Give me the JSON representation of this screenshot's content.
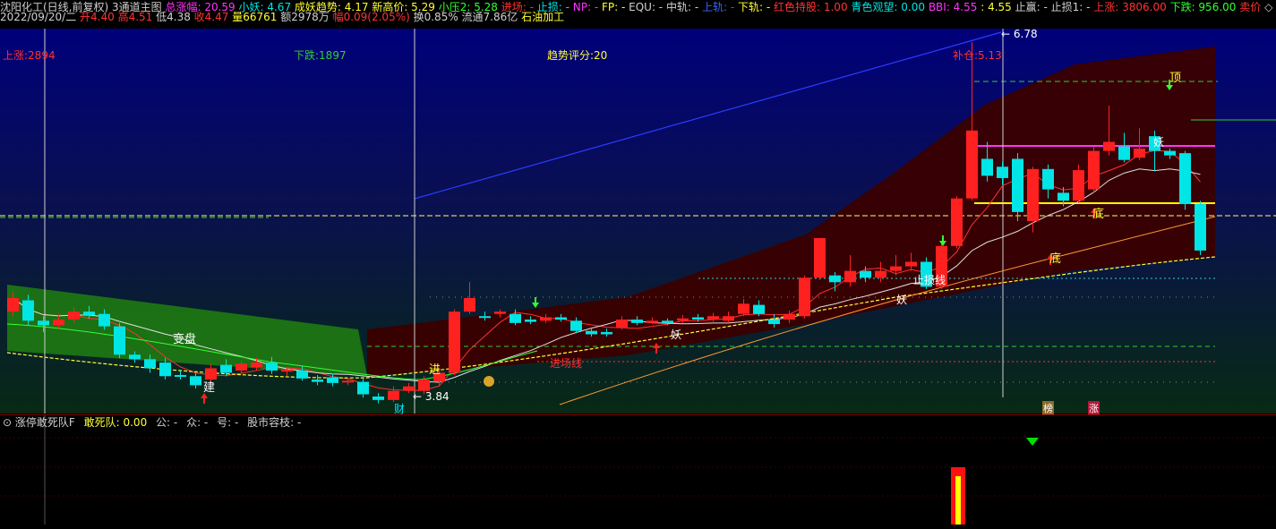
{
  "header_row1": [
    {
      "text": "沈阳化工(日线,前复权)",
      "color": "#d0d0d0"
    },
    {
      "text": " ",
      "color": "#d0d0d0"
    },
    {
      "text": "3通道主图",
      "color": "#d0d0d0"
    },
    {
      "text": " 总涨幅: 20.59",
      "color": "#ff33ff"
    },
    {
      "text": " 小妖: 4.67",
      "color": "#00e5e5"
    },
    {
      "text": " 成妖趋势: 4.17",
      "color": "#ffff33"
    },
    {
      "text": " 新高价: 5.29",
      "color": "#ffff33"
    },
    {
      "text": " 小压2: 5.28",
      "color": "#33ff33"
    },
    {
      "text": " 进场: -",
      "color": "#ff3333"
    },
    {
      "text": " 止损: -",
      "color": "#00e5e5"
    },
    {
      "text": " NP: -",
      "color": "#ff33ff"
    },
    {
      "text": " FP: -",
      "color": "#ffff33"
    },
    {
      "text": " EQU: -",
      "color": "#d0d0d0"
    },
    {
      "text": " 中轨: -",
      "color": "#d0d0d0"
    },
    {
      "text": " 上轨: -",
      "color": "#3366ff"
    },
    {
      "text": " 下轨: -",
      "color": "#ffff33"
    },
    {
      "text": " 红色持股: 1.00",
      "color": "#ff3333"
    },
    {
      "text": " 青色观望: 0.00",
      "color": "#00e5e5"
    },
    {
      "text": " BBI: 4.55",
      "color": "#ff33ff"
    },
    {
      "text": " : 4.55",
      "color": "#ffff33"
    },
    {
      "text": " 止赢: -",
      "color": "#d0d0d0"
    },
    {
      "text": " 止损1: -",
      "color": "#d0d0d0"
    },
    {
      "text": " 上涨: 3806.00",
      "color": "#ff3333"
    },
    {
      "text": " 下跌: 956.00",
      "color": "#33ff33"
    },
    {
      "text": " 卖价",
      "color": "#ff3333"
    },
    {
      "text": " ◇",
      "color": "#d0d0d0"
    }
  ],
  "header_row2": [
    {
      "text": "2022/09/20/二",
      "color": "#d0d0d0"
    },
    {
      "text": " 开4.40",
      "color": "#ff3333"
    },
    {
      "text": " 高4.51",
      "color": "#ff3333"
    },
    {
      "text": " 低4.38",
      "color": "#d0d0d0"
    },
    {
      "text": " 收4.47",
      "color": "#ff3333"
    },
    {
      "text": " 量66761",
      "color": "#ffff33"
    },
    {
      "text": " 额2978万",
      "color": "#d0d0d0"
    },
    {
      "text": " 幅0.09(2.05%)",
      "color": "#ff3333"
    },
    {
      "text": " 换0.85%",
      "color": "#d0d0d0"
    },
    {
      "text": " 流通7.86亿",
      "color": "#d0d0d0"
    },
    {
      "text": " 石油加工",
      "color": "#ffff33"
    }
  ],
  "chart_labels": {
    "up_count": "上涨:2894",
    "down_count": "下跌:1897",
    "trend_score": "趋势评分:20",
    "add_position": "补仓:5.13",
    "high_marker": "6.78",
    "low_marker": "3.84",
    "enter_line": "进场线",
    "stop_line": "止损线",
    "variable": "变盘",
    "build": "建",
    "enter": "进",
    "cai": "财",
    "yao": "妖",
    "top": "顶",
    "bottom": "底",
    "bang": "榜",
    "zhang": "涨"
  },
  "subpanel": {
    "name": "涨停敢死队F",
    "title_value": "敢死队: 0.00",
    "items": [
      "公: -",
      "众: -",
      "号: -",
      "股市容枝: -"
    ]
  },
  "colors": {
    "up": "#ff2020",
    "down": "#00e5e5",
    "accent": "#ffff00",
    "magenta": "#ff33ff",
    "green": "#33cc33",
    "blue": "#3355ff",
    "white": "#ffffff"
  },
  "chart_data": {
    "type": "candlestick",
    "title": "沈阳化工(日线,前复权)",
    "candles": [
      {
        "o": 4.4,
        "c": 4.52,
        "h": 4.58,
        "l": 4.36
      },
      {
        "o": 4.5,
        "c": 4.32,
        "h": 4.55,
        "l": 4.28
      },
      {
        "o": 4.32,
        "c": 4.28,
        "h": 4.36,
        "l": 4.22
      },
      {
        "o": 4.28,
        "c": 4.33,
        "h": 4.38,
        "l": 4.25
      },
      {
        "o": 4.33,
        "c": 4.4,
        "h": 4.44,
        "l": 4.3
      },
      {
        "o": 4.4,
        "c": 4.37,
        "h": 4.45,
        "l": 4.34
      },
      {
        "o": 4.38,
        "c": 4.27,
        "h": 4.42,
        "l": 4.24
      },
      {
        "o": 4.27,
        "c": 4.02,
        "h": 4.3,
        "l": 3.99
      },
      {
        "o": 4.02,
        "c": 3.98,
        "h": 4.05,
        "l": 3.95
      },
      {
        "o": 3.98,
        "c": 3.9,
        "h": 4.02,
        "l": 3.86
      },
      {
        "o": 3.95,
        "c": 3.83,
        "h": 3.99,
        "l": 3.8
      },
      {
        "o": 3.84,
        "c": 3.83,
        "h": 3.88,
        "l": 3.8
      },
      {
        "o": 3.83,
        "c": 3.75,
        "h": 3.86,
        "l": 3.72
      },
      {
        "o": 3.8,
        "c": 3.9,
        "h": 3.94,
        "l": 3.76
      },
      {
        "o": 3.93,
        "c": 3.86,
        "h": 3.98,
        "l": 3.83
      },
      {
        "o": 3.88,
        "c": 3.94,
        "h": 3.97,
        "l": 3.85
      },
      {
        "o": 3.91,
        "c": 3.95,
        "h": 3.99,
        "l": 3.88
      },
      {
        "o": 3.95,
        "c": 3.88,
        "h": 4.0,
        "l": 3.85
      },
      {
        "o": 3.87,
        "c": 3.89,
        "h": 3.91,
        "l": 3.83
      },
      {
        "o": 3.88,
        "c": 3.81,
        "h": 3.92,
        "l": 3.79
      },
      {
        "o": 3.8,
        "c": 3.78,
        "h": 3.84,
        "l": 3.75
      },
      {
        "o": 3.82,
        "c": 3.77,
        "h": 3.85,
        "l": 3.74
      },
      {
        "o": 3.78,
        "c": 3.79,
        "h": 3.82,
        "l": 3.75
      },
      {
        "o": 3.78,
        "c": 3.67,
        "h": 3.81,
        "l": 3.64
      },
      {
        "o": 3.65,
        "c": 3.62,
        "h": 3.68,
        "l": 3.59
      },
      {
        "o": 3.62,
        "c": 3.7,
        "h": 3.74,
        "l": 3.6
      },
      {
        "o": 3.7,
        "c": 3.74,
        "h": 3.77,
        "l": 3.68
      },
      {
        "o": 3.7,
        "c": 3.8,
        "h": 3.83,
        "l": 3.67
      },
      {
        "o": 3.78,
        "c": 3.86,
        "h": 3.89,
        "l": 3.75
      },
      {
        "o": 3.86,
        "c": 4.4,
        "h": 4.42,
        "l": 3.84
      },
      {
        "o": 4.4,
        "c": 4.52,
        "h": 4.66,
        "l": 4.38
      },
      {
        "o": 4.36,
        "c": 4.35,
        "h": 4.4,
        "l": 4.32
      },
      {
        "o": 4.38,
        "c": 4.4,
        "h": 4.42,
        "l": 4.35
      },
      {
        "o": 4.38,
        "c": 4.3,
        "h": 4.42,
        "l": 4.28
      },
      {
        "o": 4.33,
        "c": 4.31,
        "h": 4.36,
        "l": 4.29
      },
      {
        "o": 4.32,
        "c": 4.35,
        "h": 4.38,
        "l": 4.3
      },
      {
        "o": 4.35,
        "c": 4.33,
        "h": 4.38,
        "l": 4.31
      },
      {
        "o": 4.32,
        "c": 4.23,
        "h": 4.35,
        "l": 4.21
      },
      {
        "o": 4.23,
        "c": 4.2,
        "h": 4.26,
        "l": 4.18
      },
      {
        "o": 4.22,
        "c": 4.2,
        "h": 4.25,
        "l": 4.18
      },
      {
        "o": 4.26,
        "c": 4.33,
        "h": 4.36,
        "l": 4.24
      },
      {
        "o": 4.33,
        "c": 4.3,
        "h": 4.36,
        "l": 4.28
      },
      {
        "o": 4.3,
        "c": 4.32,
        "h": 4.35,
        "l": 4.29
      },
      {
        "o": 4.32,
        "c": 4.3,
        "h": 4.34,
        "l": 4.28
      },
      {
        "o": 4.32,
        "c": 4.34,
        "h": 4.37,
        "l": 4.3
      },
      {
        "o": 4.35,
        "c": 4.33,
        "h": 4.38,
        "l": 4.31
      },
      {
        "o": 4.33,
        "c": 4.36,
        "h": 4.39,
        "l": 4.31
      },
      {
        "o": 4.32,
        "c": 4.36,
        "h": 4.4,
        "l": 4.3
      },
      {
        "o": 4.38,
        "c": 4.47,
        "h": 4.51,
        "l": 4.36
      },
      {
        "o": 4.46,
        "c": 4.38,
        "h": 4.5,
        "l": 4.36
      },
      {
        "o": 4.33,
        "c": 4.29,
        "h": 4.38,
        "l": 4.26
      },
      {
        "o": 4.33,
        "c": 4.38,
        "h": 4.41,
        "l": 4.3
      },
      {
        "o": 4.36,
        "c": 4.7,
        "h": 4.72,
        "l": 4.34
      },
      {
        "o": 4.7,
        "c": 5.05,
        "h": 5.05,
        "l": 4.68
      },
      {
        "o": 4.72,
        "c": 4.66,
        "h": 4.75,
        "l": 4.58
      },
      {
        "o": 4.66,
        "c": 4.76,
        "h": 4.9,
        "l": 4.62
      },
      {
        "o": 4.76,
        "c": 4.7,
        "h": 4.8,
        "l": 4.66
      },
      {
        "o": 4.7,
        "c": 4.76,
        "h": 4.84,
        "l": 4.66
      },
      {
        "o": 4.76,
        "c": 4.8,
        "h": 4.9,
        "l": 4.72
      },
      {
        "o": 4.8,
        "c": 4.84,
        "h": 4.92,
        "l": 4.76
      },
      {
        "o": 4.84,
        "c": 4.62,
        "h": 4.88,
        "l": 4.6
      },
      {
        "o": 4.62,
        "c": 4.98,
        "h": 5.0,
        "l": 4.6
      },
      {
        "o": 4.98,
        "c": 5.4,
        "h": 5.42,
        "l": 4.96
      },
      {
        "o": 5.4,
        "c": 6.0,
        "h": 6.78,
        "l": 5.38
      },
      {
        "o": 5.75,
        "c": 5.6,
        "h": 5.9,
        "l": 5.55
      },
      {
        "o": 5.68,
        "c": 5.58,
        "h": 5.72,
        "l": 5.52
      },
      {
        "o": 5.75,
        "c": 5.28,
        "h": 5.8,
        "l": 5.2
      },
      {
        "o": 5.2,
        "c": 5.66,
        "h": 5.68,
        "l": 5.1
      },
      {
        "o": 5.66,
        "c": 5.48,
        "h": 5.7,
        "l": 5.4
      },
      {
        "o": 5.45,
        "c": 5.38,
        "h": 5.5,
        "l": 5.33
      },
      {
        "o": 5.38,
        "c": 5.65,
        "h": 5.7,
        "l": 5.36
      },
      {
        "o": 5.48,
        "c": 5.82,
        "h": 5.86,
        "l": 5.45
      },
      {
        "o": 5.82,
        "c": 5.9,
        "h": 6.22,
        "l": 5.78
      },
      {
        "o": 5.86,
        "c": 5.74,
        "h": 5.98,
        "l": 5.72
      },
      {
        "o": 5.76,
        "c": 5.84,
        "h": 6.02,
        "l": 5.74
      },
      {
        "o": 5.95,
        "c": 5.82,
        "h": 6.0,
        "l": 5.64
      },
      {
        "o": 5.82,
        "c": 5.78,
        "h": 5.84,
        "l": 5.75
      },
      {
        "o": 5.8,
        "c": 5.35,
        "h": 5.82,
        "l": 5.3
      },
      {
        "o": 5.35,
        "c": 4.94,
        "h": 5.38,
        "l": 4.9
      }
    ]
  }
}
